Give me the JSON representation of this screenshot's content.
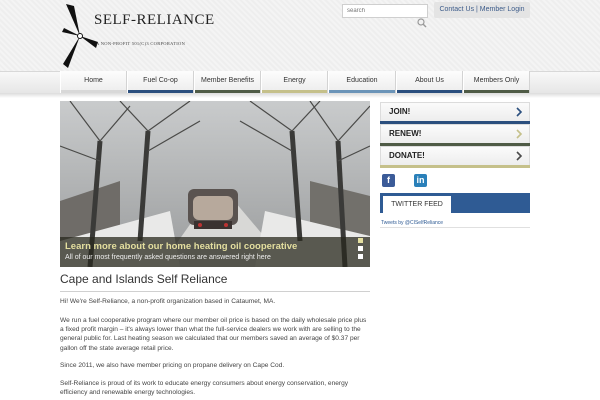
{
  "header": {
    "logo_name": "SELF-RELIANCE",
    "logo_tagline": "A NON-PROFIT 501(C)3 CORPORATION",
    "search_placeholder": "search",
    "top_links": {
      "contact": "Contact Us",
      "separator": " | ",
      "login": "Member Login"
    }
  },
  "nav": {
    "items": [
      {
        "label": "Home",
        "accent": "#d8d8d8"
      },
      {
        "label": "Fuel Co-op",
        "accent": "#2b4f7e"
      },
      {
        "label": "Member Benefits",
        "accent": "#4f5b46"
      },
      {
        "label": "Energy",
        "accent": "#c5c08a"
      },
      {
        "label": "Education",
        "accent": "#6b94b8"
      },
      {
        "label": "About Us",
        "accent": "#2b4f7e"
      },
      {
        "label": "Members Only",
        "accent": "#4f5b46"
      }
    ]
  },
  "hero": {
    "title": "Learn more about our home heating oil cooperative",
    "subtitle": "All of our most frequently asked questions are answered right here",
    "slides": 3,
    "active_slide": 1
  },
  "main": {
    "title": "Cape and Islands Self Reliance",
    "paragraphs": [
      "Hi! We're Self-Reliance, a non-profit organization based in Cataumet, MA.",
      "We run a fuel cooperative program where our member oil price is based on the daily wholesale price plus a fixed profit margin – it's always lower than what the full-service dealers we work with are selling to the general public for. Last heating season we calculated that our members saved an average of $0.37 per gallon off the state average retail price.",
      "Since 2011, we also have member pricing on propane delivery on Cape Cod.",
      "Self-Reliance is proud of its work to educate energy consumers about energy conservation, energy efficiency and renewable energy technologies."
    ]
  },
  "sidebar": {
    "buttons": [
      {
        "label": "JOIN!",
        "accent": "#2b4f7e",
        "chevron": "#2b4f7e"
      },
      {
        "label": "RENEW!",
        "accent": "#4f5b46",
        "chevron": "#c5c08a"
      },
      {
        "label": "DONATE!",
        "accent": "#c5c08a",
        "chevron": "#4a4a4a"
      }
    ],
    "social": {
      "facebook": "f",
      "linkedin": "in"
    },
    "twitter_tab": "TWITTER FEED",
    "tweets_by": "Tweets by @CISelfReliance"
  }
}
